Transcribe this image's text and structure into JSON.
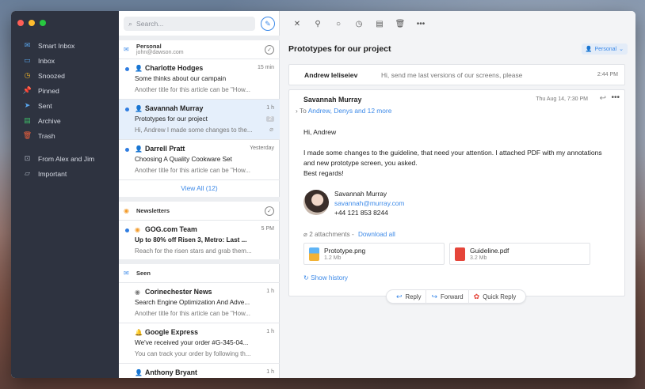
{
  "window": {
    "traffic_colors": [
      "#ff5f57",
      "#febc2e",
      "#28c840"
    ]
  },
  "sidebar": {
    "items": [
      {
        "label": "Smart Inbox",
        "icon": "smart-inbox-icon",
        "color": "#5aa8f0"
      },
      {
        "label": "Inbox",
        "icon": "inbox-icon",
        "color": "#5aa8f0"
      },
      {
        "label": "Snoozed",
        "icon": "clock-icon",
        "color": "#f0b429"
      },
      {
        "label": "Pinned",
        "icon": "pin-icon",
        "color": "#f0603c"
      },
      {
        "label": "Sent",
        "icon": "send-icon",
        "color": "#5aa8f0"
      },
      {
        "label": "Archive",
        "icon": "archive-icon",
        "color": "#3fbf6a"
      },
      {
        "label": "Trash",
        "icon": "trash-icon",
        "color": "#f0603c"
      }
    ],
    "folders": [
      {
        "label": "From Alex and Jim",
        "icon": "smart-folder-icon"
      },
      {
        "label": "Important",
        "icon": "folder-icon"
      }
    ]
  },
  "list": {
    "search_placeholder": "Search...",
    "groups": {
      "personal": {
        "title": "Personal",
        "subtitle": "john@dawson.com"
      },
      "newsletters": {
        "title": "Newsletters"
      },
      "seen": {
        "title": "Seen"
      }
    },
    "messages": [
      {
        "sender": "Charlotte Hodges",
        "time": "15 min",
        "subject": "Some thinks about our campain",
        "preview": "Another title for this article can be \"How...",
        "unread": true
      },
      {
        "sender": "Savannah Murray",
        "time": "1 h",
        "subject": "Prototypes for our project",
        "preview": "Hi, Andrew I made some changes to the...",
        "unread": true,
        "badge": "2"
      },
      {
        "sender": "Darrell Pratt",
        "time": "Yesterday",
        "subject": "Choosing A Quality Cookware Set",
        "preview": "Another title for this article can be \"How...",
        "unread": true
      }
    ],
    "view_all": "View All (12)",
    "newsletter_messages": [
      {
        "sender": "GOG.com Team",
        "time": "5 PM",
        "subject": "Up to 80% off Risen 3, Metro: Last ...",
        "preview": "Reach for the risen stars and grab them...",
        "unread": true
      }
    ],
    "seen_messages": [
      {
        "sender": "Corinechester News",
        "time": "1 h",
        "subject": "Search Engine Optimization And Adve...",
        "preview": "Another title for this article can be \"How..."
      },
      {
        "sender": "Google Express",
        "time": "1 h",
        "subject": "We've received your order #G-345-04...",
        "preview": "You can track your order by following th..."
      },
      {
        "sender": "Anthony Bryant",
        "time": "1 h",
        "subject": "",
        "preview": ""
      }
    ]
  },
  "reader": {
    "subject": "Prototypes for our project",
    "account_label": "Personal",
    "collapsed": {
      "sender": "Andrew Ieliseiev",
      "preview": "Hi, send me last versions of our screens, please",
      "time": "2:44 PM"
    },
    "message": {
      "sender": "Savannah Murray",
      "to_prefix": "To",
      "to_names": "Andrew, Denys and 12 more",
      "date": "Thu Aug 14, 7:30 PM",
      "greeting": "Hi, Andrew",
      "body": "I made some changes to the guideline, that need your attention. I attached PDF with my annotations and new prototype screen, you asked.",
      "closing": "Best regards!",
      "signature": {
        "name": "Savannah Murray",
        "email": "savannah@murray.com",
        "phone": "+44 121 853 8244"
      },
      "attachments_label": "2 attachments",
      "download_all": "Download all",
      "attachments": [
        {
          "name": "Prototype.png",
          "size": "1.2 Mb",
          "color": "#f2b235"
        },
        {
          "name": "Guideline.pdf",
          "size": "3.2 Mb",
          "color": "#e5453a"
        }
      ],
      "show_history": "Show history"
    },
    "actions": {
      "reply": "Reply",
      "forward": "Forward",
      "quick_reply": "Quick Reply"
    }
  }
}
